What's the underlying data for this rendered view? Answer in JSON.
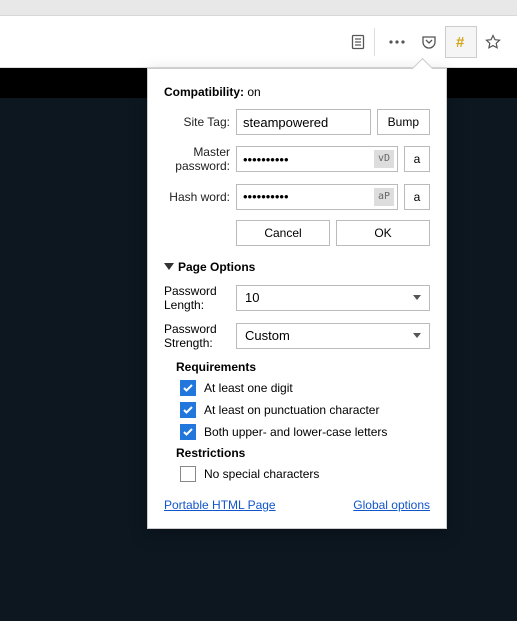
{
  "compat": {
    "label": "Compatibility:",
    "value": "on"
  },
  "siteTag": {
    "label": "Site Tag:",
    "value": "steampowered",
    "bump": "Bump"
  },
  "master": {
    "label": "Master password:",
    "value": "••••••••••",
    "badge": "vD",
    "reveal": "a"
  },
  "hash": {
    "label": "Hash word:",
    "value": "••••••••••",
    "badge": "aP",
    "reveal": "a"
  },
  "cancel": "Cancel",
  "ok": "OK",
  "pageOptions": "Page Options",
  "pwLen": {
    "label": "Password Length:",
    "value": "10"
  },
  "pwStr": {
    "label": "Password Strength:",
    "value": "Custom"
  },
  "reqHeader": "Requirements",
  "req1": "At least one digit",
  "req2": "At least on punctuation character",
  "req3": "Both upper- and lower-case letters",
  "restHeader": "Restrictions",
  "rest1": "No special characters",
  "linkPortable": "Portable HTML Page",
  "linkGlobal": "Global options"
}
